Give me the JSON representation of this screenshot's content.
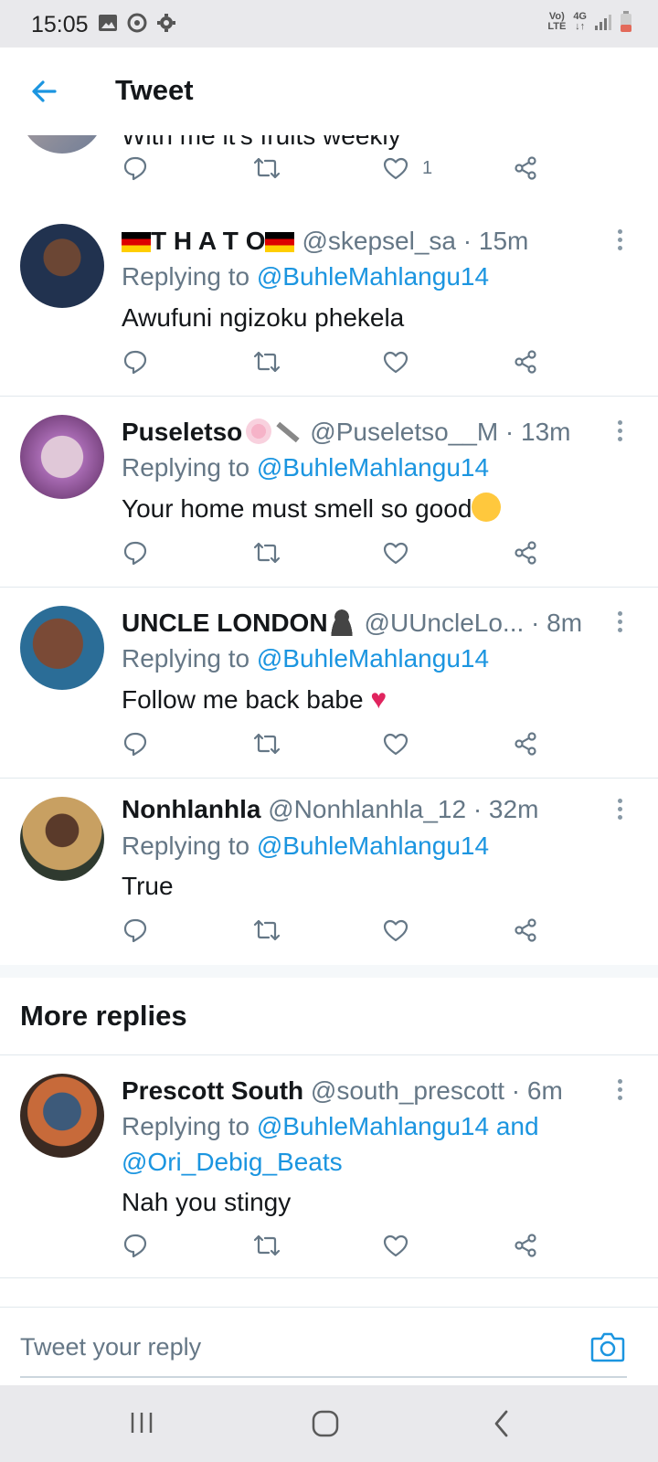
{
  "status_bar": {
    "time": "15:05",
    "network_label_top": "Vo)",
    "network_label_bottom": "LTE",
    "network_type": "4G"
  },
  "app_bar": {
    "title": "Tweet"
  },
  "partial_tweet": {
    "text": "With me it's fruits weekly",
    "like_count": "1"
  },
  "tweets": [
    {
      "name": "T H A T O",
      "handle": "@skepsel_sa",
      "time": "· 15m",
      "replying_prefix": "Replying to ",
      "mention": "@BuhleMahlangu14",
      "mention_extra": "",
      "mention2": "",
      "text": "Awufuni ngizoku phekela"
    },
    {
      "name": "Puseletso",
      "handle": "@Puseletso__M",
      "time": "· 13m",
      "replying_prefix": "Replying to ",
      "mention": "@BuhleMahlangu14",
      "mention_extra": "",
      "mention2": "",
      "text": "Your home must smell so good"
    },
    {
      "name": "UNCLE LONDON",
      "handle": "@UUncleLo...",
      "time": "· 8m",
      "replying_prefix": "Replying to ",
      "mention": "@BuhleMahlangu14",
      "mention_extra": "",
      "mention2": "",
      "text": "Follow me back babe"
    },
    {
      "name": "Nonhlanhla",
      "handle": "@Nonhlanhla_12",
      "time": "· 32m",
      "replying_prefix": "Replying to ",
      "mention": "@BuhleMahlangu14",
      "mention_extra": "",
      "mention2": "",
      "text": "True"
    }
  ],
  "more_replies": {
    "label": "More replies",
    "tweet": {
      "name": "Prescott South",
      "handle": "@south_prescott",
      "time": "· 6m",
      "replying_prefix": "Replying to ",
      "mention": "@BuhleMahlangu14",
      "mention_extra": " and",
      "mention2": "@Ori_Debig_Beats",
      "text": "Nah you stingy"
    }
  },
  "reply_bar": {
    "placeholder": "Tweet your reply"
  },
  "colors": {
    "accent": "#1b95e0",
    "text": "#14171a",
    "muted": "#657786",
    "like": "#e0245e"
  },
  "icons": [
    "back-arrow-icon",
    "reply-icon",
    "retweet-icon",
    "like-icon",
    "share-icon",
    "more-icon",
    "camera-icon",
    "recent-apps-icon",
    "home-icon",
    "back-nav-icon"
  ]
}
